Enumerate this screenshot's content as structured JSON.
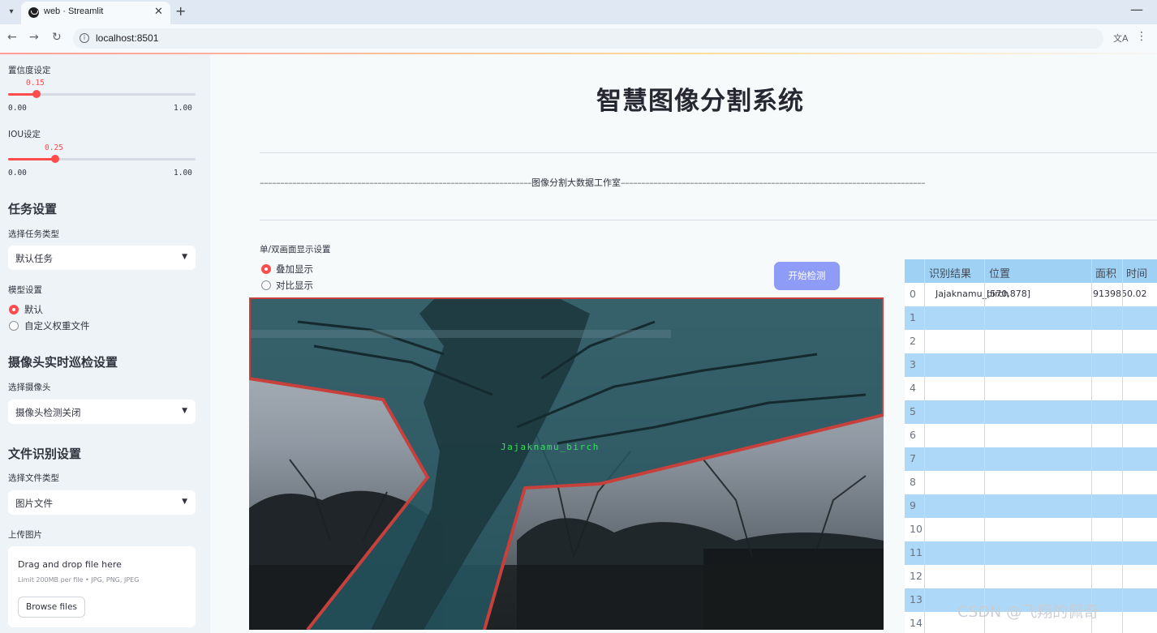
{
  "browser": {
    "tab_title": "web · Streamlit",
    "url": "localhost:8501",
    "new_tab_symbol": "+",
    "close_symbol": "✕",
    "minimize_symbol": "—"
  },
  "sidebar": {
    "confidence": {
      "label": "置信度设定",
      "value": "0.15",
      "fraction": 0.15,
      "min": "0.00",
      "max": "1.00"
    },
    "iou": {
      "label": "IOU设定",
      "value": "0.25",
      "fraction": 0.25,
      "min": "0.00",
      "max": "1.00"
    },
    "task_section": "任务设置",
    "task_type_label": "选择任务类型",
    "task_type_value": "默认任务",
    "model_label": "模型设置",
    "model_options": [
      "默认",
      "自定义权重文件"
    ],
    "model_selected": 0,
    "camera_section": "摄像头实时巡检设置",
    "camera_label": "选择摄像头",
    "camera_value": "摄像头检测关闭",
    "file_section": "文件识别设置",
    "file_type_label": "选择文件类型",
    "file_type_value": "图片文件",
    "upload_label": "上传图片",
    "upload_title": "Drag and drop file here",
    "upload_limit": "Limit 200MB per file • JPG, PNG, JPEG",
    "browse_label": "Browse files"
  },
  "main": {
    "title": "智慧图像分割系统",
    "subtitle": "图像分割大数据工作室",
    "display_label": "单/双画面显示设置",
    "display_options": [
      "叠加显示",
      "对比显示"
    ],
    "display_selected": 0,
    "start_button": "开始检测",
    "detection_label": "Jajaknamu_birch"
  },
  "table": {
    "columns": [
      "识别结果",
      "位置",
      "面积",
      "时间"
    ],
    "rows": [
      {
        "index": "0",
        "result": "Jajaknamu_birch",
        "position": "[570,878]",
        "area": "9139850.02",
        "time": ""
      },
      {
        "index": "1"
      },
      {
        "index": "2"
      },
      {
        "index": "3"
      },
      {
        "index": "4"
      },
      {
        "index": "5"
      },
      {
        "index": "6"
      },
      {
        "index": "7"
      },
      {
        "index": "8"
      },
      {
        "index": "9"
      },
      {
        "index": "10"
      },
      {
        "index": "11"
      },
      {
        "index": "12"
      },
      {
        "index": "13"
      },
      {
        "index": "14"
      }
    ]
  },
  "watermark": "CSDN @飞翔的佩奇",
  "colors": {
    "accent": "#ff4b4b",
    "button": "#8e9cf7",
    "table_header": "#9fd1f5",
    "table_alt": "#add8f7",
    "mask_outline": "#c8403c"
  }
}
